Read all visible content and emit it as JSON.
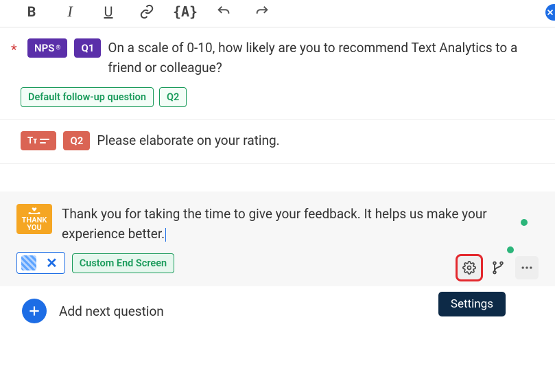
{
  "toolbar": {
    "bold": "B",
    "italic": "I",
    "underline": "U",
    "variable": "{A}"
  },
  "q1": {
    "required": "*",
    "type_badge": "NPS",
    "type_badge_sup": "®",
    "num_badge": "Q1",
    "text": "On a scale of 0-10, how likely are you to recommend Text Analytics to a friend or colleague?",
    "followup_label": "Default follow-up question",
    "followup_badge": "Q2"
  },
  "q2": {
    "num_badge": "Q2",
    "text": "Please elaborate on your rating."
  },
  "thankyou": {
    "badge_line1": "THANK",
    "badge_line2": "YOU",
    "text": "Thank you for taking the time to give your feedback. It helps us make your experience better.",
    "custom_end_label": "Custom End Screen",
    "tooltip": "Settings"
  },
  "add_next": "Add next question"
}
